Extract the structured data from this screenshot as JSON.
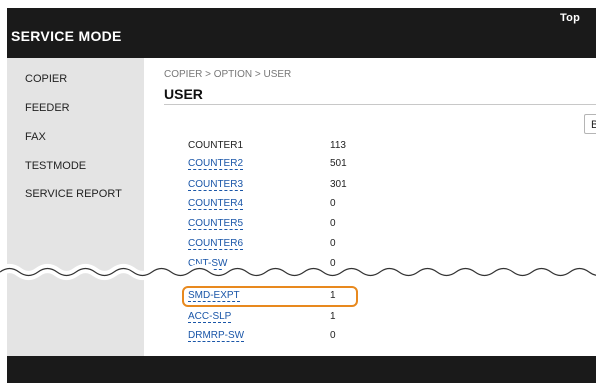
{
  "header": {
    "top_link": "Top",
    "app_title": "SERVICE MODE"
  },
  "sidebar": {
    "items": [
      {
        "label": "COPIER"
      },
      {
        "label": "FEEDER"
      },
      {
        "label": "FAX"
      },
      {
        "label": "TESTMODE"
      },
      {
        "label": "SERVICE REPORT"
      }
    ]
  },
  "main": {
    "breadcrumb": "COPIER > OPTION > USER",
    "title": "USER",
    "side_button_label": "B",
    "rows": [
      {
        "key": "COUNTER1",
        "value": "113",
        "link": false
      },
      {
        "key": "COUNTER2",
        "value": "501",
        "link": true
      },
      {
        "key": "COUNTER3",
        "value": "301",
        "link": true
      },
      {
        "key": "COUNTER4",
        "value": "0",
        "link": true
      },
      {
        "key": "COUNTER5",
        "value": "0",
        "link": true
      },
      {
        "key": "COUNTER6",
        "value": "0",
        "link": true
      },
      {
        "key": "CNT-SW",
        "value": "0",
        "link": true
      },
      {
        "key": "SMD-EXPT",
        "value": "1",
        "link": true
      },
      {
        "key": "ACC-SLP",
        "value": "1",
        "link": true
      },
      {
        "key": "DRMRP-SW",
        "value": "0",
        "link": true
      }
    ]
  },
  "colors": {
    "header_bg": "#1a1a1a",
    "sidebar_bg": "#e4e4e4",
    "link": "#1a56a8",
    "highlight": "#e8891e"
  }
}
